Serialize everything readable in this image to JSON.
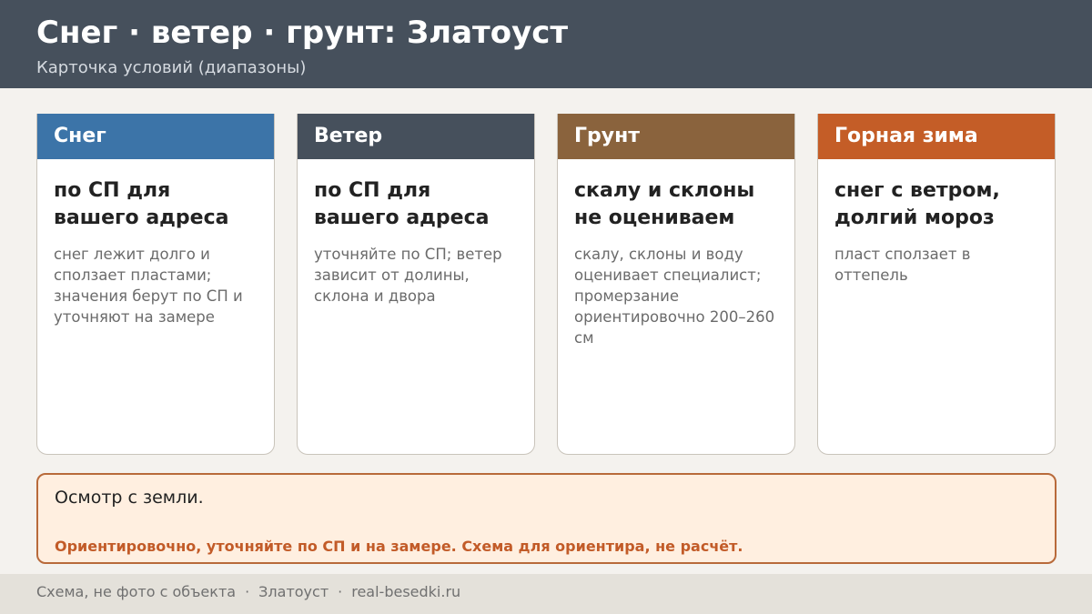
{
  "header": {
    "title": "Снег · ветер · грунт: Златоуст",
    "subtitle": "Карточка условий (диапазоны)"
  },
  "cards": [
    {
      "label": "Снег",
      "color": "#3c74a8",
      "main": "по СП для вашего адреса",
      "desc": "снег лежит долго и сползает пластами; значения берут по СП и уточняют на замере"
    },
    {
      "label": "Ветер",
      "color": "#46505c",
      "main": "по СП для вашего адреса",
      "desc": "уточняйте по СП; ветер зависит от долины, склона и двора"
    },
    {
      "label": "Грунт",
      "color": "#8a633d",
      "main": "скалу и склоны не оцениваем",
      "desc": "скалу, склоны и воду оценивает специалист; промерзание ориентировочно 200–260 см"
    },
    {
      "label": "Горная зима",
      "color": "#c45d27",
      "main": "снег с ветром, долгий мороз",
      "desc": "пласт сползает в оттепель"
    }
  ],
  "note": {
    "text": "Осмотр с земли.",
    "warning": "Ориентировочно, уточняйте по СП и на замере. Схема для ориентира, не расчёт."
  },
  "footer": {
    "part1": "Схема, не фото с объекта",
    "separator": "·",
    "part2": "Златоуст",
    "part3": "real-besedki.ru"
  }
}
